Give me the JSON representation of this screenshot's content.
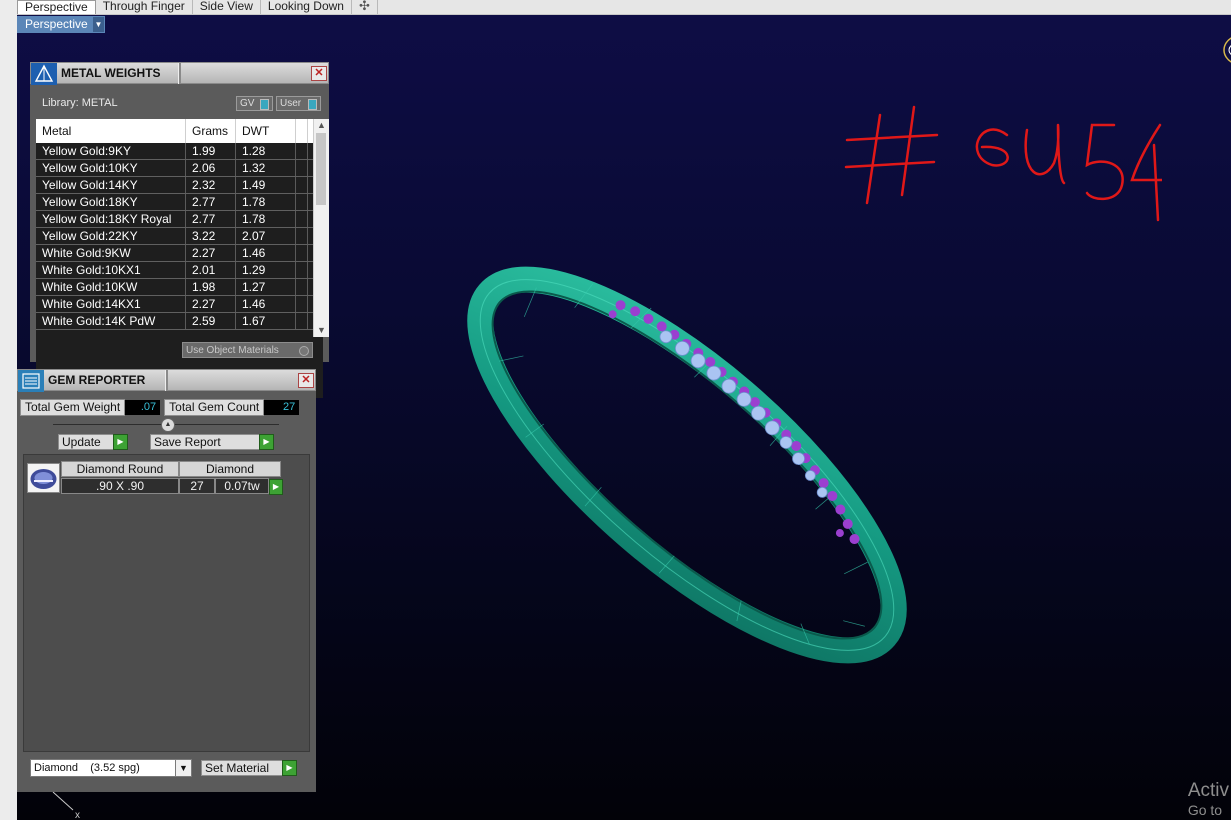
{
  "tabs": [
    {
      "label": "Perspective",
      "active": true
    },
    {
      "label": "Through Finger",
      "active": false
    },
    {
      "label": "Side View",
      "active": false
    },
    {
      "label": "Looking Down",
      "active": false
    }
  ],
  "viewport": {
    "label": "Perspective",
    "handwriting": "# eu 54",
    "watermark": {
      "line1": "Activ",
      "line2": "Go to"
    }
  },
  "metal_panel": {
    "title": "METAL WEIGHTS",
    "library_label": "Library: METAL",
    "toggle_gv": "GV",
    "toggle_user": "User",
    "columns": [
      "Metal",
      "Grams",
      "DWT"
    ],
    "rows": [
      {
        "metal": "Yellow Gold:9KY",
        "grams": "1.99",
        "dwt": "1.28"
      },
      {
        "metal": "Yellow Gold:10KY",
        "grams": "2.06",
        "dwt": "1.32"
      },
      {
        "metal": "Yellow Gold:14KY",
        "grams": "2.32",
        "dwt": "1.49"
      },
      {
        "metal": "Yellow Gold:18KY",
        "grams": "2.77",
        "dwt": "1.78"
      },
      {
        "metal": "Yellow Gold:18KY Royal",
        "grams": "2.77",
        "dwt": "1.78"
      },
      {
        "metal": "Yellow Gold:22KY",
        "grams": "3.22",
        "dwt": "2.07"
      },
      {
        "metal": "White Gold:9KW",
        "grams": "2.27",
        "dwt": "1.46"
      },
      {
        "metal": "White Gold:10KX1",
        "grams": "2.01",
        "dwt": "1.29"
      },
      {
        "metal": "White Gold:10KW",
        "grams": "1.98",
        "dwt": "1.27"
      },
      {
        "metal": "White Gold:14KX1",
        "grams": "2.27",
        "dwt": "1.46"
      },
      {
        "metal": "White Gold:14K PdW",
        "grams": "2.59",
        "dwt": "1.67"
      }
    ],
    "use_object_materials": "Use Object Materials"
  },
  "gem_panel": {
    "title": "GEM REPORTER",
    "total_weight_label": "Total Gem Weight",
    "total_weight_value": ".07",
    "total_count_label": "Total Gem Count",
    "total_count_value": "27",
    "update_label": "Update",
    "save_report_label": "Save Report",
    "gem": {
      "shape": "Diamond Round",
      "material": "Diamond",
      "size": ".90 X .90",
      "count": "27",
      "weight": "0.07tw"
    },
    "material_select": "Diamond    (3.52 spg)",
    "set_material_label": "Set Material"
  },
  "colors": {
    "ring": "#1fa58c",
    "gem_prongs": "#9b3fd0",
    "diamonds": "#aac4f2",
    "handwriting": "#e01818"
  }
}
